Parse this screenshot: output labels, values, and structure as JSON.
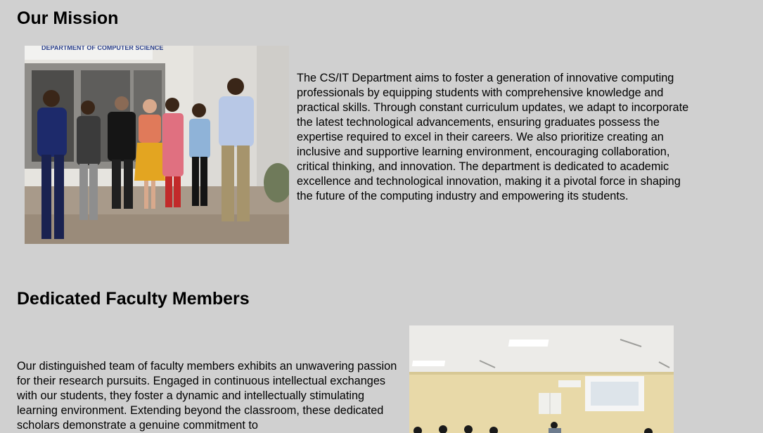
{
  "mission": {
    "heading": "Our Mission",
    "paragraph": "The CS/IT Department aims to foster a generation of innovative computing professionals by equipping students with comprehensive knowledge and practical skills. Through constant curriculum updates, we adapt to incorporate the latest technological advancements, ensuring graduates possess the expertise required to excel in their careers. We also prioritize creating an inclusive and supportive learning environment, encouraging collaboration, critical thinking, and innovation. The department is dedicated to academic excellence and technological innovation, making it a pivotal force in shaping the future of the computing industry and empowering its students.",
    "photo_sign": "DEPARTMENT OF COMPUTER SCIENCE"
  },
  "faculty": {
    "heading": "Dedicated Faculty Members",
    "paragraph": "Our distinguished team of faculty members exhibits an unwavering passion for their research pursuits. Engaged in continuous intellectual exchanges with our students, they foster a dynamic and intellectually stimulating learning environment. Extending beyond the classroom, these dedicated scholars demonstrate a genuine commitment to"
  },
  "colors": {
    "background": "#d0d0d0",
    "text": "#000000"
  }
}
